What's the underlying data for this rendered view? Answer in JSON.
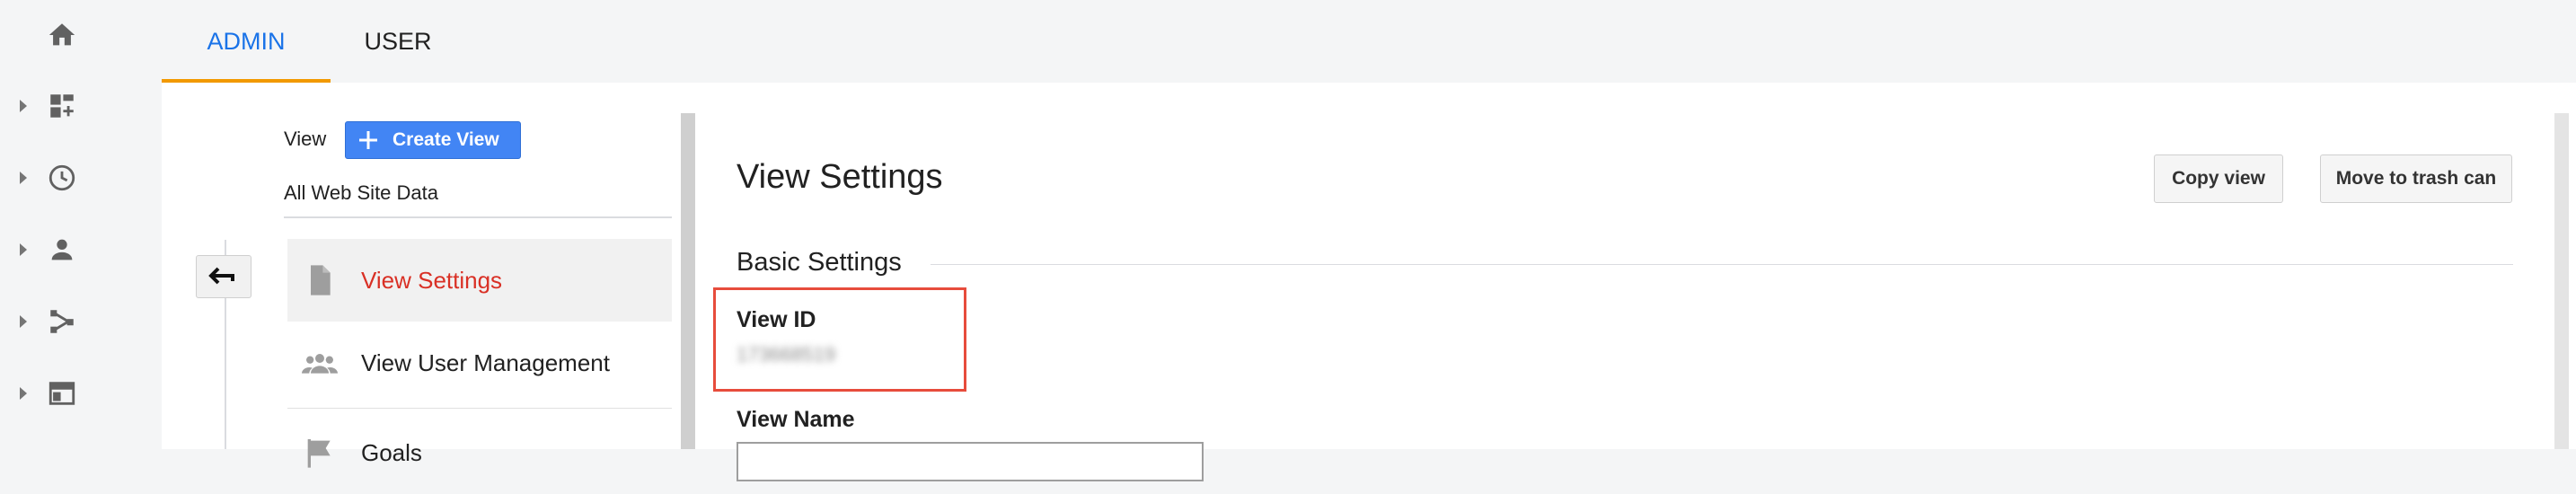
{
  "tabs": [
    {
      "label": "ADMIN",
      "active": true
    },
    {
      "label": "USER",
      "active": false
    }
  ],
  "left_nav": {
    "icons": [
      "home-icon",
      "customization-icon",
      "realtime-clock-icon",
      "audience-person-icon",
      "acquisition-icon",
      "behavior-icon"
    ]
  },
  "view_column": {
    "label": "View",
    "create_button": "Create View",
    "property_name": "All Web Site Data",
    "items": [
      {
        "label": "View Settings",
        "icon": "document-icon",
        "active": true
      },
      {
        "label": "View User Management",
        "icon": "users-icon",
        "active": false
      },
      {
        "label": "Goals",
        "icon": "flag-icon",
        "active": false
      }
    ]
  },
  "settings": {
    "title": "View Settings",
    "copy_button": "Copy view",
    "trash_button": "Move to trash can",
    "section": "Basic Settings",
    "view_id_label": "View ID",
    "view_id_value": "173668519",
    "view_name_label": "View Name"
  },
  "colors": {
    "accent": "#1a73e8",
    "tab_underline": "#f29900",
    "active_menu_text": "#d93025",
    "create_button": "#4285f4",
    "highlight": "#e74c3c"
  }
}
